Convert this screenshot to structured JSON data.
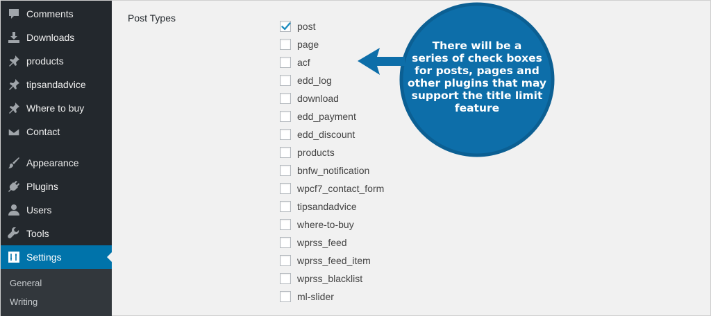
{
  "sidebar": {
    "items": [
      {
        "label": "Comments",
        "icon": "comments-icon"
      },
      {
        "label": "Downloads",
        "icon": "downloads-icon"
      },
      {
        "label": "products",
        "icon": "pin-icon"
      },
      {
        "label": "tipsandadvice",
        "icon": "pin-icon"
      },
      {
        "label": "Where to buy",
        "icon": "pin-icon"
      },
      {
        "label": "Contact",
        "icon": "envelope-icon"
      },
      {
        "label": "Appearance",
        "icon": "paintbrush-icon"
      },
      {
        "label": "Plugins",
        "icon": "plug-icon"
      },
      {
        "label": "Users",
        "icon": "user-icon"
      },
      {
        "label": "Tools",
        "icon": "wrench-icon"
      },
      {
        "label": "Settings",
        "icon": "settings-icon",
        "current": true
      }
    ],
    "submenu": [
      {
        "label": "General"
      },
      {
        "label": "Writing"
      }
    ]
  },
  "main": {
    "section_label": "Post Types",
    "post_types": [
      {
        "label": "post",
        "checked": true
      },
      {
        "label": "page",
        "checked": false
      },
      {
        "label": "acf",
        "checked": false
      },
      {
        "label": "edd_log",
        "checked": false
      },
      {
        "label": "download",
        "checked": false
      },
      {
        "label": "edd_payment",
        "checked": false
      },
      {
        "label": "edd_discount",
        "checked": false
      },
      {
        "label": "products",
        "checked": false
      },
      {
        "label": "bnfw_notification",
        "checked": false
      },
      {
        "label": "wpcf7_contact_form",
        "checked": false
      },
      {
        "label": "tipsandadvice",
        "checked": false
      },
      {
        "label": "where-to-buy",
        "checked": false
      },
      {
        "label": "wprss_feed",
        "checked": false
      },
      {
        "label": "wprss_feed_item",
        "checked": false
      },
      {
        "label": "wprss_blacklist",
        "checked": false
      },
      {
        "label": "ml-slider",
        "checked": false
      }
    ]
  },
  "callout": {
    "lines": [
      "There will be a",
      "series of check boxes",
      "for posts, pages and",
      "other plugins that may",
      "support the title limit",
      "feature"
    ],
    "color": "#0d6ea9",
    "border_color": "#0b5f93",
    "text_color": "#ffffff"
  },
  "colors": {
    "sidebar_bg": "#23282d",
    "accent": "#0073aa",
    "check": "#1e8cbe"
  }
}
